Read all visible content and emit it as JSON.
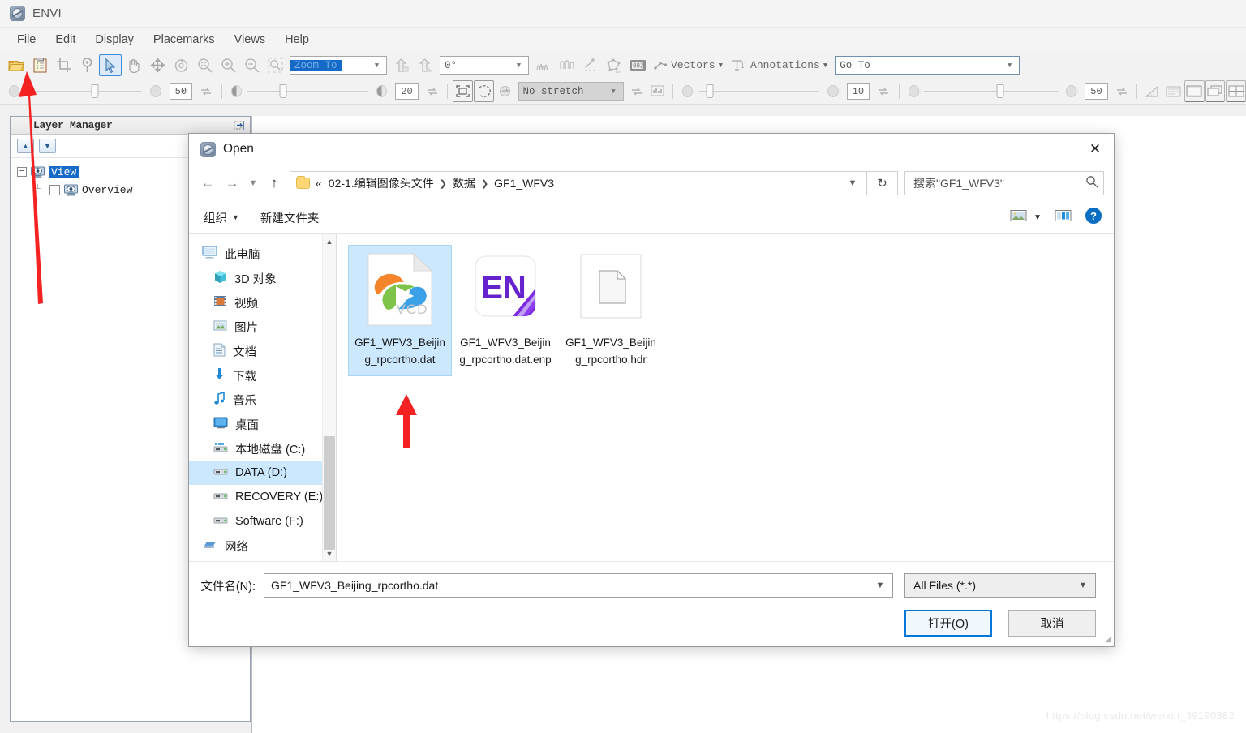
{
  "app": {
    "title": "ENVI",
    "icon": "envi-logo-icon",
    "menus": [
      "File",
      "Edit",
      "Display",
      "Placemarks",
      "Views",
      "Help"
    ],
    "toolbar_row1": {
      "icons": [
        "open-file-icon",
        "paste-clipboard-icon",
        "crop-icon",
        "placemark-pin-icon",
        "select-cursor-icon",
        "pan-hand-icon",
        "fly-move-icon",
        "rotate-icon",
        "zoom-fit-icon",
        "zoom-in-icon",
        "zoom-out-icon",
        "zoom-region-icon"
      ],
      "selected_icon": "select-cursor-icon",
      "zoom_combo_value": "Zoom To",
      "rotation_value": "0°",
      "after_icons": [
        "bring-to-front-icon",
        "send-to-back-icon",
        "spectral-profile-icon",
        "horizontal-profile-icon",
        "arbitrary-profile-icon",
        "roi-tool-icon",
        "band-math-icon"
      ],
      "vectors_label": "Vectors",
      "annotations_label": "Annotations",
      "goto_value": "Go To"
    },
    "toolbar_row2": {
      "transparency_value": "50",
      "brightness_value": "20",
      "stretch_value": "No stretch",
      "sharpen_value": "10",
      "blend_value": "50"
    }
  },
  "layer_manager": {
    "title": "Layer Manager",
    "up_icon": "chevron-up-icon",
    "down_icon": "chevron-down-icon",
    "pin_icon": "pin-panel-icon",
    "nodes": [
      {
        "label": "View",
        "selected": true
      },
      {
        "label": "Overview",
        "selected": false
      }
    ]
  },
  "dialog": {
    "title": "Open",
    "icon": "envi-logo-icon",
    "close_icon": "close-icon",
    "nav": {
      "back_icon": "arrow-left-icon",
      "forward_icon": "arrow-right-icon",
      "recent_icon": "chevron-down-icon",
      "up_icon": "arrow-up-icon",
      "folder_icon": "folder-icon",
      "overflow": "«",
      "breadcrumbs": [
        "02-1.编辑图像头文件",
        "数据",
        "GF1_WFV3"
      ],
      "dropdown_icon": "chevron-down-icon",
      "refresh_icon": "refresh-icon",
      "search_placeholder": "搜索\"GF1_WFV3\"",
      "search_icon": "search-icon"
    },
    "commands": {
      "organize": "组织",
      "new_folder": "新建文件夹",
      "view_icon": "view-mode-icon",
      "view_caret_icon": "chevron-down-icon",
      "preview_icon": "preview-pane-icon",
      "help_icon": "help-icon"
    },
    "nav_pane": {
      "scroll_up_icon": "chevron-up-icon",
      "scroll_down_icon": "chevron-down-icon",
      "items": [
        {
          "label": "此电脑",
          "icon": "this-pc-icon",
          "indent": false,
          "selected": false
        },
        {
          "label": "3D 对象",
          "icon": "3d-objects-icon",
          "indent": true,
          "selected": false
        },
        {
          "label": "视频",
          "icon": "videos-icon",
          "indent": true,
          "selected": false
        },
        {
          "label": "图片",
          "icon": "pictures-icon",
          "indent": true,
          "selected": false
        },
        {
          "label": "文档",
          "icon": "documents-icon",
          "indent": true,
          "selected": false
        },
        {
          "label": "下载",
          "icon": "downloads-icon",
          "indent": true,
          "selected": false
        },
        {
          "label": "音乐",
          "icon": "music-icon",
          "indent": true,
          "selected": false
        },
        {
          "label": "桌面",
          "icon": "desktop-icon",
          "indent": true,
          "selected": false
        },
        {
          "label": "本地磁盘 (C:)",
          "icon": "local-disk-icon",
          "indent": true,
          "selected": false
        },
        {
          "label": "DATA (D:)",
          "icon": "drive-icon",
          "indent": true,
          "selected": true
        },
        {
          "label": "RECOVERY (E:)",
          "icon": "drive-icon",
          "indent": true,
          "selected": false
        },
        {
          "label": "Software (F:)",
          "icon": "drive-icon",
          "indent": true,
          "selected": false
        },
        {
          "label": "网络",
          "icon": "network-icon",
          "indent": false,
          "selected": false
        }
      ]
    },
    "files": [
      {
        "name": "GF1_WFV3_Beijing_rpcortho.dat",
        "icon": "tencent-video-vcd-icon",
        "selected": true
      },
      {
        "name": "GF1_WFV3_Beijing_rpcortho.dat.enp",
        "icon": "endnote-en-icon",
        "selected": false
      },
      {
        "name": "GF1_WFV3_Beijing_rpcortho.hdr",
        "icon": "blank-document-icon",
        "selected": false
      }
    ],
    "footer": {
      "filename_label": "文件名(N):",
      "filename_value": "GF1_WFV3_Beijing_rpcortho.dat",
      "filename_caret_icon": "chevron-down-icon",
      "filter_value": "All Files (*.*)",
      "filter_caret_icon": "chevron-down-icon",
      "open_button": "打开(O)",
      "cancel_button": "取消"
    }
  },
  "annotations": {
    "arrow_color": "#f52222",
    "arrows": [
      "arrow-to-open-toolbar-button",
      "arrow-to-selected-dat-file"
    ]
  },
  "watermark": "https://blog.csdn.net/weixin_39190382"
}
